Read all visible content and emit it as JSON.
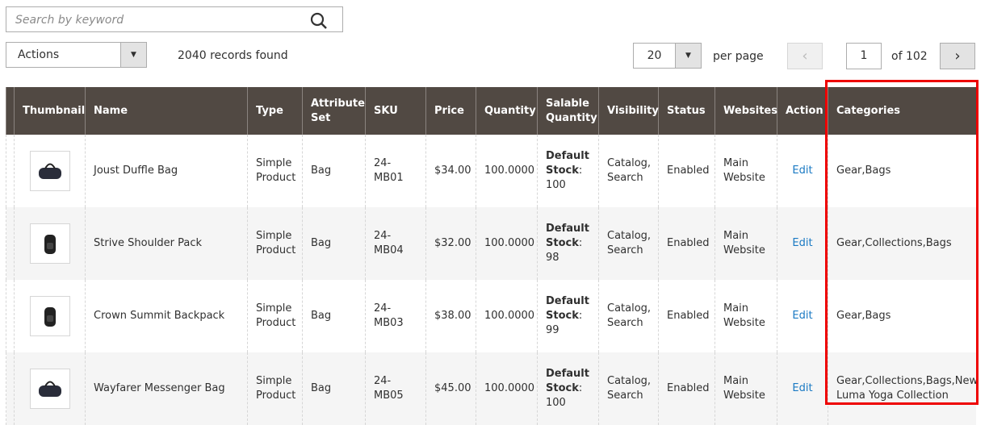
{
  "search": {
    "placeholder": "Search by keyword"
  },
  "actions": {
    "label": "Actions"
  },
  "records": "2040 records found",
  "pager": {
    "per_page": "20",
    "per_page_label": "per page",
    "page": "1",
    "of": "of 102"
  },
  "columns": [
    "Thumbnail",
    "Name",
    "Type",
    "Attribute Set",
    "SKU",
    "Price",
    "Quantity",
    "Salable Quantity",
    "Visibility",
    "Status",
    "Websites",
    "Action",
    "Categories"
  ],
  "rows": [
    {
      "name": "Joust Duffle Bag",
      "type": "Simple Product",
      "attr": "Bag",
      "sku": "24-MB01",
      "price": "$34.00",
      "qty": "100.0000",
      "sal_label": "Default Stock",
      "sal_val": "100",
      "vis": "Catalog, Search",
      "status": "Enabled",
      "web": "Main Website",
      "action": "Edit",
      "cat": "Gear,Bags"
    },
    {
      "name": "Strive Shoulder Pack",
      "type": "Simple Product",
      "attr": "Bag",
      "sku": "24-MB04",
      "price": "$32.00",
      "qty": "100.0000",
      "sal_label": "Default Stock",
      "sal_val": "98",
      "vis": "Catalog, Search",
      "status": "Enabled",
      "web": "Main Website",
      "action": "Edit",
      "cat": "Gear,Collections,Bags"
    },
    {
      "name": "Crown Summit Backpack",
      "type": "Simple Product",
      "attr": "Bag",
      "sku": "24-MB03",
      "price": "$38.00",
      "qty": "100.0000",
      "sal_label": "Default Stock",
      "sal_val": "99",
      "vis": "Catalog, Search",
      "status": "Enabled",
      "web": "Main Website",
      "action": "Edit",
      "cat": "Gear,Bags"
    },
    {
      "name": "Wayfarer Messenger Bag",
      "type": "Simple Product",
      "attr": "Bag",
      "sku": "24-MB05",
      "price": "$45.00",
      "qty": "100.0000",
      "sal_label": "Default Stock",
      "sal_val": "100",
      "vis": "Catalog, Search",
      "status": "Enabled",
      "web": "Main Website",
      "action": "Edit",
      "cat": "Gear,Collections,Bags,New Luma Yoga Collection"
    }
  ]
}
